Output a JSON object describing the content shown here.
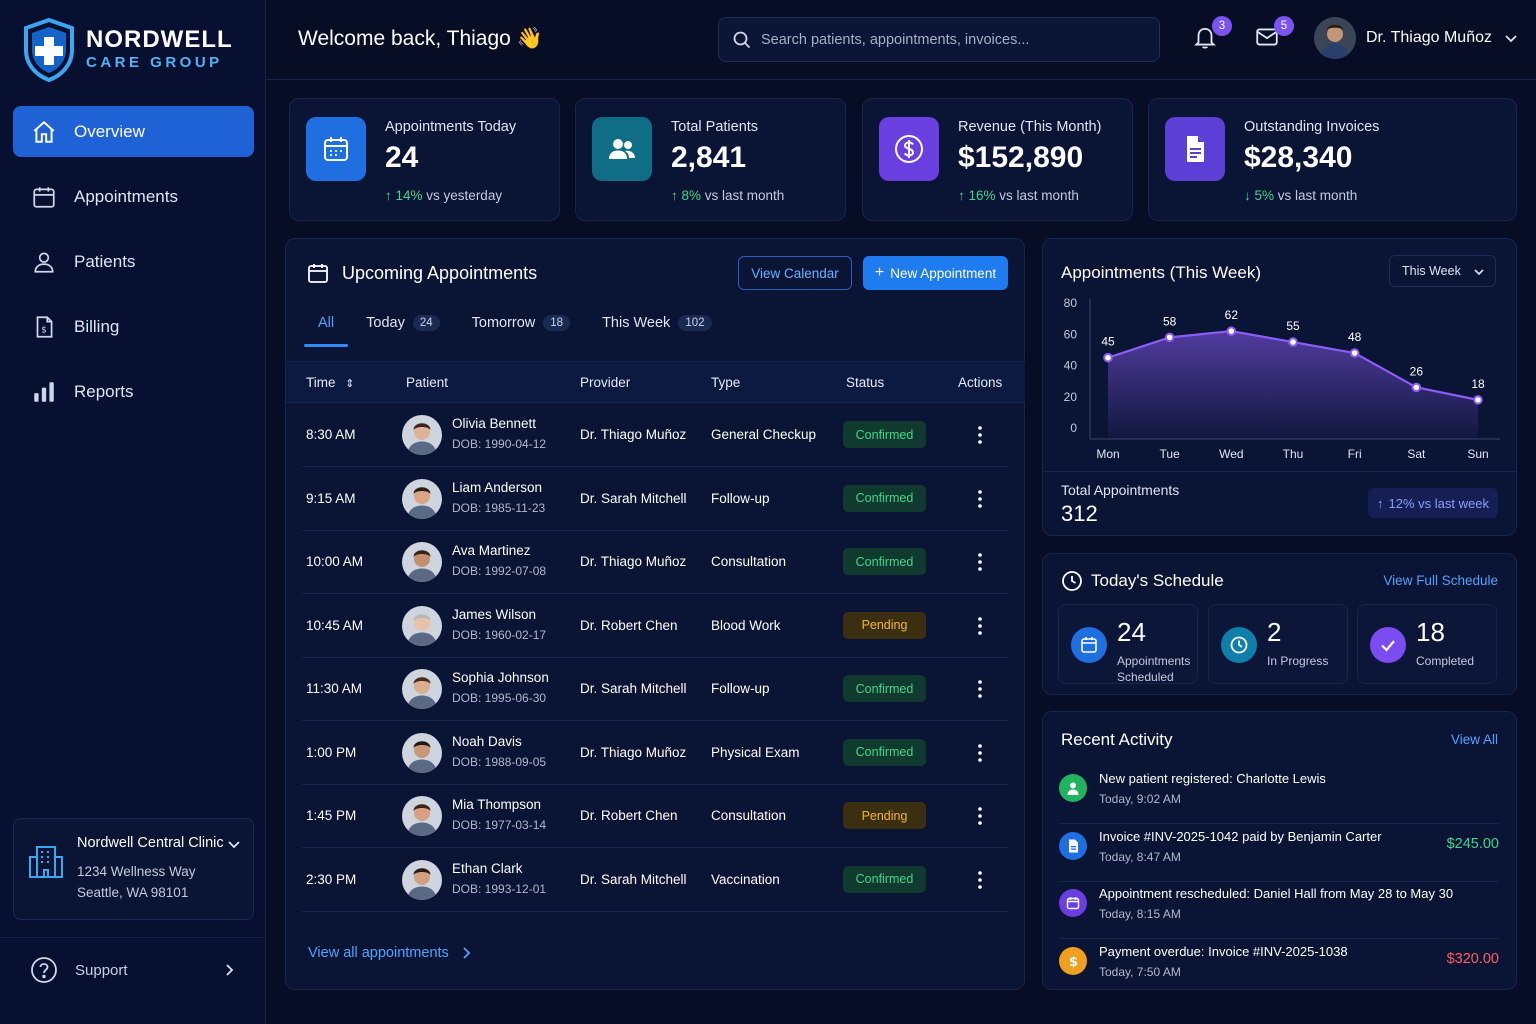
{
  "brand": {
    "name": "NORDWELL",
    "sub": "CARE GROUP"
  },
  "nav": [
    {
      "label": "Overview",
      "icon": "home-icon",
      "active": true
    },
    {
      "label": "Appointments",
      "icon": "calendar-icon",
      "active": false
    },
    {
      "label": "Patients",
      "icon": "user-icon",
      "active": false
    },
    {
      "label": "Billing",
      "icon": "invoice-icon",
      "active": false
    },
    {
      "label": "Reports",
      "icon": "bar-chart-icon",
      "active": false
    }
  ],
  "clinic": {
    "name": "Nordwell Central Clinic",
    "address1": "1234 Wellness Way",
    "address2": "Seattle, WA 98101"
  },
  "support": {
    "label": "Support"
  },
  "header": {
    "welcome": "Welcome back, Thiago 👋",
    "search_placeholder": "Search patients, appointments, invoices...",
    "notifications": "3",
    "messages": "5",
    "user_name": "Dr. Thiago Muñoz"
  },
  "stats": [
    {
      "label": "Appointments Today",
      "value": "24",
      "delta": "14%",
      "delta_text": " vs yesterday",
      "direction": "up",
      "color": "#1f6fe0",
      "icon": "calendar-icon"
    },
    {
      "label": "Total Patients",
      "value": "2,841",
      "delta": "8%",
      "delta_text": " vs last month",
      "direction": "up",
      "color": "#0f6e86",
      "icon": "users-icon"
    },
    {
      "label": "Revenue (This Month)",
      "value": "$152,890",
      "delta": "16%",
      "delta_text": " vs last month",
      "direction": "up",
      "color": "#6a3fe0",
      "icon": "dollar-icon"
    },
    {
      "label": "Outstanding Invoices",
      "value": "$28,340",
      "delta": "5%",
      "delta_text": " vs last month",
      "direction": "down",
      "color": "#5b3fd6",
      "icon": "document-icon"
    }
  ],
  "appointments": {
    "title": "Upcoming Appointments",
    "view_calendar": "View Calendar",
    "new_appointment": "New Appointment",
    "tabs": [
      {
        "label": "All",
        "count": ""
      },
      {
        "label": "Today",
        "count": "24"
      },
      {
        "label": "Tomorrow",
        "count": "18"
      },
      {
        "label": "This Week",
        "count": "102"
      }
    ],
    "columns": {
      "time": "Time",
      "patient": "Patient",
      "provider": "Provider",
      "type": "Type",
      "status": "Status",
      "actions": "Actions"
    },
    "rows": [
      {
        "time": "8:30 AM",
        "name": "Olivia Bennett",
        "dob": "DOB: 1990-04-12",
        "provider": "Dr. Thiago Muñoz",
        "type": "General Checkup",
        "status": "Confirmed"
      },
      {
        "time": "9:15 AM",
        "name": "Liam Anderson",
        "dob": "DOB: 1985-11-23",
        "provider": "Dr. Sarah Mitchell",
        "type": "Follow-up",
        "status": "Confirmed"
      },
      {
        "time": "10:00 AM",
        "name": "Ava Martinez",
        "dob": "DOB: 1992-07-08",
        "provider": "Dr. Thiago Muñoz",
        "type": "Consultation",
        "status": "Confirmed"
      },
      {
        "time": "10:45 AM",
        "name": "James Wilson",
        "dob": "DOB: 1960-02-17",
        "provider": "Dr. Robert Chen",
        "type": "Blood Work",
        "status": "Pending"
      },
      {
        "time": "11:30 AM",
        "name": "Sophia Johnson",
        "dob": "DOB: 1995-06-30",
        "provider": "Dr. Sarah Mitchell",
        "type": "Follow-up",
        "status": "Confirmed"
      },
      {
        "time": "1:00 PM",
        "name": "Noah Davis",
        "dob": "DOB: 1988-09-05",
        "provider": "Dr. Thiago Muñoz",
        "type": "Physical Exam",
        "status": "Confirmed"
      },
      {
        "time": "1:45 PM",
        "name": "Mia Thompson",
        "dob": "DOB: 1977-03-14",
        "provider": "Dr. Robert Chen",
        "type": "Consultation",
        "status": "Pending"
      },
      {
        "time": "2:30 PM",
        "name": "Ethan Clark",
        "dob": "DOB: 1993-12-01",
        "provider": "Dr. Sarah Mitchell",
        "type": "Vaccination",
        "status": "Confirmed"
      }
    ],
    "view_all": "View all appointments"
  },
  "weekly": {
    "title": "Appointments (This Week)",
    "range_select": "This Week",
    "total_label": "Total Appointments",
    "total_value": "312",
    "trend": "12% vs last week"
  },
  "chart_data": {
    "type": "area",
    "categories": [
      "Mon",
      "Tue",
      "Wed",
      "Thu",
      "Fri",
      "Sat",
      "Sun"
    ],
    "values": [
      45,
      58,
      62,
      55,
      48,
      26,
      18
    ],
    "title": "Appointments (This Week)",
    "ylim": [
      0,
      80
    ],
    "yticks": [
      0,
      20,
      40,
      60,
      80
    ],
    "grid": false,
    "color": "#8b5cf6"
  },
  "schedule": {
    "title": "Today's Schedule",
    "link": "View Full Schedule",
    "items": [
      {
        "value": "24",
        "label": "Appointments Scheduled",
        "color": "#1f6fe0",
        "icon": "calendar-icon"
      },
      {
        "value": "2",
        "label": "In Progress",
        "color": "#0e7fa8",
        "icon": "clock-icon"
      },
      {
        "value": "18",
        "label": "Completed",
        "color": "#7b4df0",
        "icon": "check-icon"
      }
    ]
  },
  "activity": {
    "title": "Recent Activity",
    "link": "View All",
    "items": [
      {
        "text": "New patient registered: Charlotte Lewis",
        "time": "Today, 9:02 AM",
        "amount": "",
        "amount_color": "",
        "color": "#22b35e",
        "icon": "user-icon"
      },
      {
        "text": "Invoice #INV-2025-1042 paid by Benjamin Carter",
        "time": "Today, 8:47 AM",
        "amount": "$245.00",
        "amount_color": "#3dd68c",
        "color": "#1f6fe0",
        "icon": "document-icon"
      },
      {
        "text": "Appointment rescheduled: Daniel Hall from May 28 to May 30",
        "time": "Today, 8:15 AM",
        "amount": "",
        "amount_color": "",
        "color": "#6a3fe0",
        "icon": "calendar-icon"
      },
      {
        "text": "Payment overdue: Invoice #INV-2025-1038",
        "time": "Today, 7:50 AM",
        "amount": "$320.00",
        "amount_color": "#ff5d5d",
        "color": "#f0a020",
        "icon": "dollar-icon"
      }
    ]
  }
}
